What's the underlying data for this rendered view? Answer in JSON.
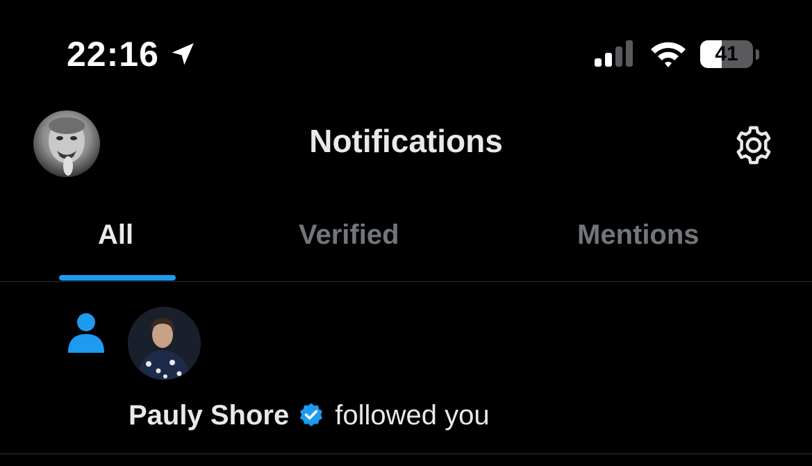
{
  "status_bar": {
    "time": "22:16",
    "battery_level": "41",
    "battery_percent": 41,
    "icons": [
      "location-arrow-icon",
      "cellular-signal-icon",
      "wifi-icon",
      "battery-icon"
    ]
  },
  "header": {
    "title": "Notifications",
    "icons": [
      "profile-avatar",
      "gear-icon"
    ]
  },
  "tabs": [
    {
      "label": "All",
      "active": true
    },
    {
      "label": "Verified",
      "active": false
    },
    {
      "label": "Mentions",
      "active": false
    }
  ],
  "notifications": [
    {
      "type": "follow",
      "icon": "person-icon",
      "user_name": "Pauly Shore",
      "verified": true,
      "action": "followed you"
    }
  ],
  "colors": {
    "background": "#000000",
    "text_primary": "#e7e9ea",
    "text_secondary": "#71767b",
    "accent": "#1d9bf0",
    "divider": "#2f3336"
  }
}
